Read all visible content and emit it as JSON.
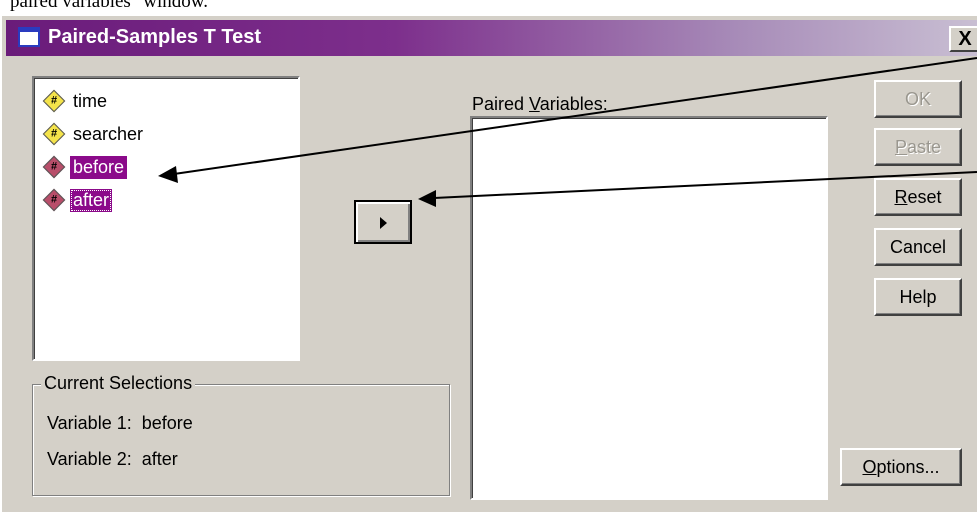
{
  "document": {
    "text": "paired variables\" window."
  },
  "window": {
    "title": "Paired-Samples T Test",
    "close_label": "X"
  },
  "variables": [
    {
      "name": "time",
      "icon": "numeric-variable-icon",
      "selected": false
    },
    {
      "name": "searcher",
      "icon": "numeric-variable-icon",
      "selected": false
    },
    {
      "name": "before",
      "icon": "numeric-variable-icon",
      "selected": true
    },
    {
      "name": "after",
      "icon": "numeric-variable-icon",
      "selected": true
    }
  ],
  "current_selections": {
    "legend": "Current Selections",
    "var1_label": "Variable 1:",
    "var1_value": "before",
    "var2_label": "Variable 2:",
    "var2_value": "after"
  },
  "paired": {
    "label_pre": "Paired ",
    "label_accel": "V",
    "label_post": "ariables:"
  },
  "buttons": {
    "ok": {
      "label": "OK",
      "enabled": false
    },
    "paste": {
      "accel": "P",
      "rest": "aste",
      "enabled": false
    },
    "reset": {
      "accel": "R",
      "rest": "eset",
      "enabled": true
    },
    "cancel": {
      "label": "Cancel",
      "enabled": true
    },
    "help": {
      "label": "Help",
      "enabled": true
    },
    "options": {
      "accel": "O",
      "rest": "ptions...",
      "enabled": true
    }
  },
  "colors": {
    "selection": "#8b0a8a",
    "titlebar_start": "#6a1b7a",
    "dialog_bg": "#d4d0c8"
  }
}
